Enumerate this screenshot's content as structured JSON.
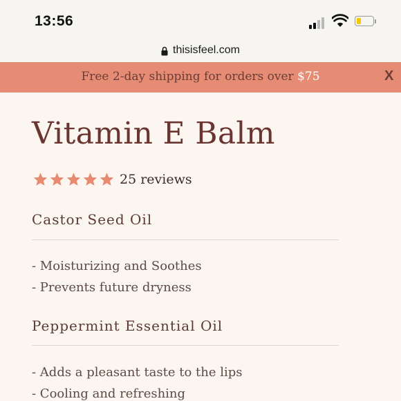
{
  "status_bar": {
    "time": "13:56"
  },
  "browser": {
    "url": "thisisfeel.com"
  },
  "promo": {
    "text": "Free 2-day shipping for orders over ",
    "amount": "$75",
    "close_label": "X"
  },
  "product": {
    "title": "Vitamin E Balm",
    "rating": {
      "stars": 5,
      "max": 5,
      "reviews_label": "25 reviews"
    }
  },
  "ingredients": [
    {
      "name": "Castor Seed Oil",
      "benefits": [
        "- Moisturizing and Soothes",
        "- Prevents future dryness"
      ]
    },
    {
      "name": "Peppermint Essential Oil",
      "benefits": [
        "- Adds a pleasant taste to the lips",
        "- Cooling and refreshing"
      ]
    }
  ],
  "colors": {
    "promo_background": "#e68c74",
    "title": "#6a3530",
    "star": "#e88a72",
    "page_background": "#fcf6f0"
  },
  "icons": [
    "signal-icon",
    "wifi-icon",
    "battery-icon",
    "lock-icon",
    "star-icon"
  ]
}
